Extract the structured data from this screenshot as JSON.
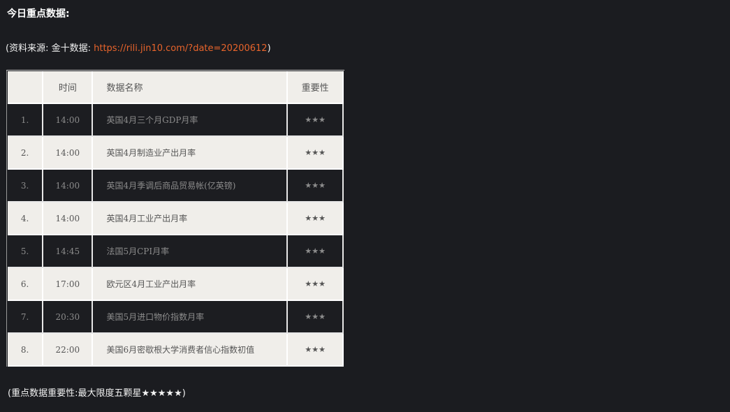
{
  "heading": "今日重点数据:",
  "source": {
    "prefix": "(资料来源: 金十数据: ",
    "link": "https://rili.jin10.com/?date=20200612",
    "suffix": ")"
  },
  "table": {
    "headers": {
      "index": "",
      "time": "时间",
      "name": "数据名称",
      "importance": "重要性"
    },
    "rows": [
      {
        "index": "1.",
        "time": "14:00",
        "name": "英国4月三个月GDP月率",
        "importance": "★★★"
      },
      {
        "index": "2.",
        "time": "14:00",
        "name": "英国4月制造业产出月率",
        "importance": "★★★"
      },
      {
        "index": "3.",
        "time": "14:00",
        "name": "英国4月季调后商品贸易帐(亿英镑)",
        "importance": "★★★"
      },
      {
        "index": "4.",
        "time": "14:00",
        "name": "英国4月工业产出月率",
        "importance": "★★★"
      },
      {
        "index": "5.",
        "time": "14:45",
        "name": "法国5月CPI月率",
        "importance": "★★★"
      },
      {
        "index": "6.",
        "time": "17:00",
        "name": "欧元区4月工业产出月率",
        "importance": "★★★"
      },
      {
        "index": "7.",
        "time": "20:30",
        "name": "美国5月进口物价指数月率",
        "importance": "★★★"
      },
      {
        "index": "8.",
        "time": "22:00",
        "name": "美国6月密歇根大学消费者信心指数初值",
        "importance": "★★★"
      }
    ]
  },
  "note": "(重点数据重要性:最大限度五颗星★★★★★)",
  "colors": {
    "background": "#1b1c20",
    "link": "#e8642b",
    "light_row": "#f0eeea",
    "dark_row": "#1c1d21"
  }
}
